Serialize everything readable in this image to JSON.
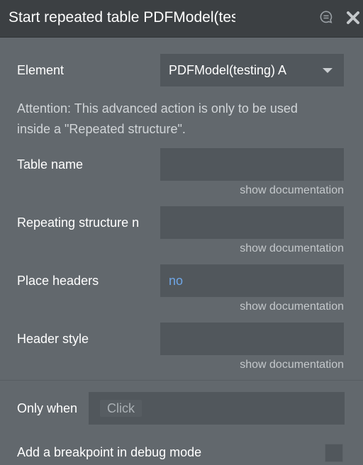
{
  "header": {
    "title": "Start repeated table PDFModel(testing) A",
    "icons": {
      "comment": "comment-icon",
      "close": "close-icon"
    }
  },
  "fields": {
    "element": {
      "label": "Element",
      "value": "PDFModel(testing) A"
    },
    "attention_text": "Attention: This advanced action is only to be used inside a \"Repeated structure\".",
    "table_name": {
      "label": "Table name",
      "value": "",
      "doc_link": "show documentation"
    },
    "repeating_structure": {
      "label": "Repeating structure n",
      "value": "",
      "doc_link": "show documentation"
    },
    "place_headers": {
      "label": "Place headers",
      "value": "no",
      "doc_link": "show documentation"
    },
    "header_style": {
      "label": "Header style",
      "value": "",
      "doc_link": "show documentation"
    }
  },
  "condition": {
    "label": "Only when",
    "placeholder": "Click"
  },
  "debug": {
    "label": "Add a breakpoint in debug mode",
    "checked": false
  },
  "colors": {
    "panel_bg": "#62686d",
    "titlebar_bg": "#3c4043",
    "input_bg": "#51575c",
    "link_blue": "#6fa6e6"
  }
}
